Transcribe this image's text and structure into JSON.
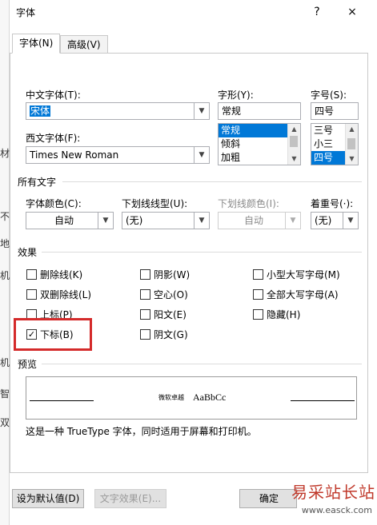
{
  "background_chars": [
    "材",
    "不",
    "地",
    "机",
    "机",
    "智",
    "双"
  ],
  "dialog": {
    "title": "字体",
    "help": "?",
    "close": "×"
  },
  "tabs": [
    {
      "label": "字体(N)"
    },
    {
      "label": "高级(V)"
    }
  ],
  "font": {
    "chinese_label": "中文字体(T):",
    "chinese_value": "宋体",
    "western_label": "西文字体(F):",
    "western_value": "Times New Roman",
    "style_label": "字形(Y):",
    "style_value": "常规",
    "style_list": [
      "常规",
      "倾斜",
      "加粗"
    ],
    "size_label": "字号(S):",
    "size_value": "四号",
    "size_list": [
      "三号",
      "小三",
      "四号"
    ]
  },
  "all_text": {
    "section": "所有文字",
    "color_label": "字体颜色(C):",
    "color_value": "自动",
    "underline_label": "下划线线型(U):",
    "underline_value": "(无)",
    "underline_color_label": "下划线颜色(I):",
    "underline_color_value": "自动",
    "emphasis_label": "着重号(·):",
    "emphasis_value": "(无)"
  },
  "effects": {
    "section": "效果",
    "items": [
      {
        "label": "删除线(K)",
        "checked": false
      },
      {
        "label": "双删除线(L)",
        "checked": false
      },
      {
        "label": "上标(P)",
        "checked": false
      },
      {
        "label": "下标(B)",
        "checked": true
      },
      {
        "label": "阴影(W)",
        "checked": false
      },
      {
        "label": "空心(O)",
        "checked": false
      },
      {
        "label": "阳文(E)",
        "checked": false
      },
      {
        "label": "阴文(G)",
        "checked": false
      },
      {
        "label": "小型大写字母(M)",
        "checked": false
      },
      {
        "label": "全部大写字母(A)",
        "checked": false
      },
      {
        "label": "隐藏(H)",
        "checked": false
      }
    ]
  },
  "preview": {
    "section": "预览",
    "sample_cjk": "微软卓越",
    "sample_latin": "AaBbCc",
    "note": "这是一种 TrueType 字体，同时适用于屏幕和打印机。"
  },
  "buttons": {
    "set_default": "设为默认值(D)",
    "text_effects": "文字效果(E)...",
    "ok": "确定"
  },
  "watermark": {
    "text": "易采站长站",
    "url": "www.easck.com"
  },
  "colors": {
    "accent": "#0078d7",
    "highlight": "#d42a2a"
  }
}
